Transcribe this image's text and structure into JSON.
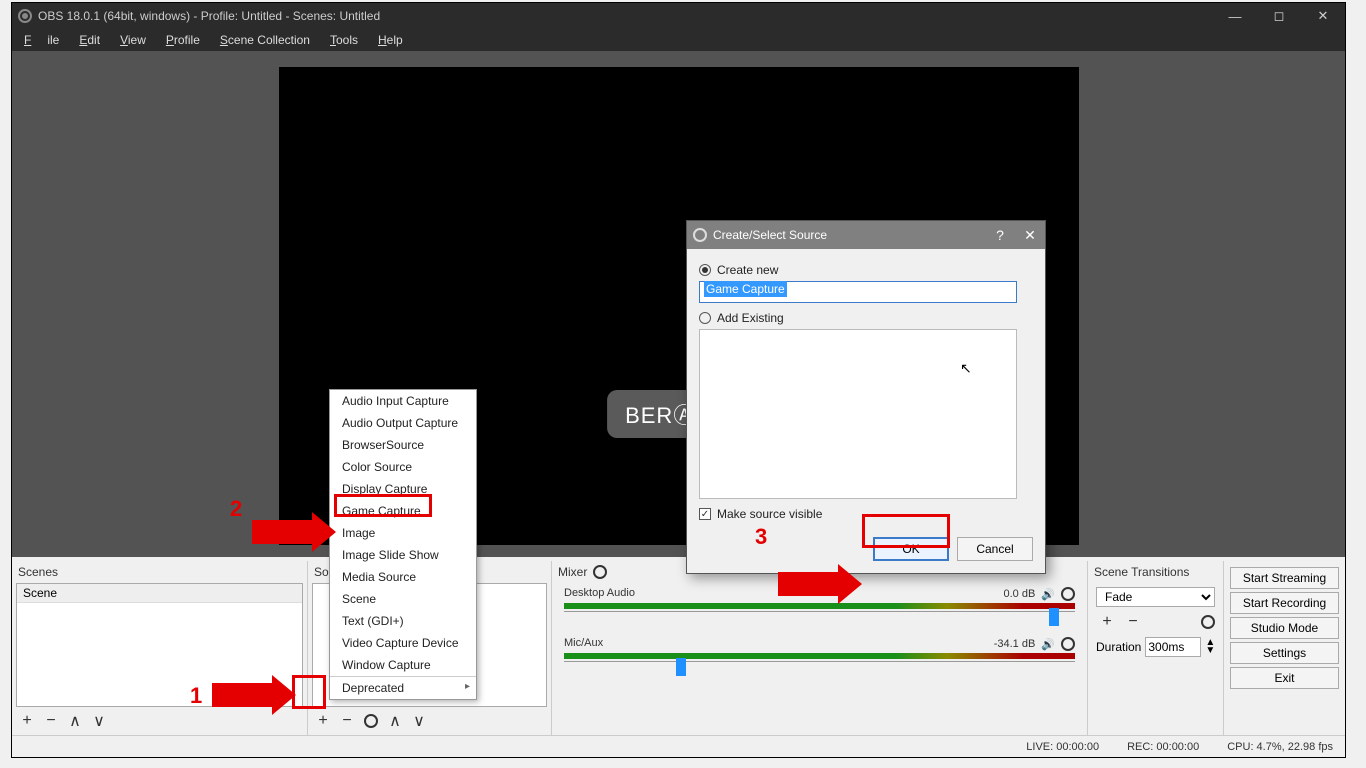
{
  "titlebar": {
    "text": "OBS 18.0.1 (64bit, windows) - Profile: Untitled - Scenes: Untitled"
  },
  "menubar": {
    "file": "File",
    "edit": "Edit",
    "view": "View",
    "profile": "Profile",
    "scene_collection": "Scene Collection",
    "tools": "Tools",
    "help": "Help"
  },
  "panels": {
    "scenes_header": "Scenes",
    "sources_header": "Sources",
    "mixer_header": "Mixer",
    "transitions_header": "Scene Transitions"
  },
  "scenes": {
    "items": [
      "Scene"
    ]
  },
  "mixer": {
    "tracks": [
      {
        "name": "Desktop Audio",
        "db": "0.0 dB",
        "thumb_pct": 95
      },
      {
        "name": "Mic/Aux",
        "db": "-34.1 dB",
        "thumb_pct": 22
      }
    ]
  },
  "transitions": {
    "selected": "Fade",
    "duration_label": "Duration",
    "duration_value": "300ms"
  },
  "controls": {
    "start_streaming": "Start Streaming",
    "start_recording": "Start Recording",
    "studio_mode": "Studio Mode",
    "settings": "Settings",
    "exit": "Exit"
  },
  "statusbar": {
    "live": "LIVE: 00:00:00",
    "rec": "REC: 00:00:00",
    "cpu": "CPU: 4.7%, 22.98 fps"
  },
  "source_menu": {
    "items": [
      "Audio Input Capture",
      "Audio Output Capture",
      "BrowserSource",
      "Color Source",
      "Display Capture",
      "Game Capture",
      "Image",
      "Image Slide Show",
      "Media Source",
      "Scene",
      "Text (GDI+)",
      "Video Capture Device",
      "Window Capture",
      "Deprecated"
    ]
  },
  "dialog": {
    "title": "Create/Select Source",
    "create_new": "Create new",
    "name_value": "Game Capture",
    "add_existing": "Add Existing",
    "make_visible": "Make source visible",
    "ok": "OK",
    "cancel": "Cancel"
  },
  "annotations": {
    "n1": "1",
    "n2": "2",
    "n3": "3"
  },
  "watermark": "BERⒶKAL"
}
